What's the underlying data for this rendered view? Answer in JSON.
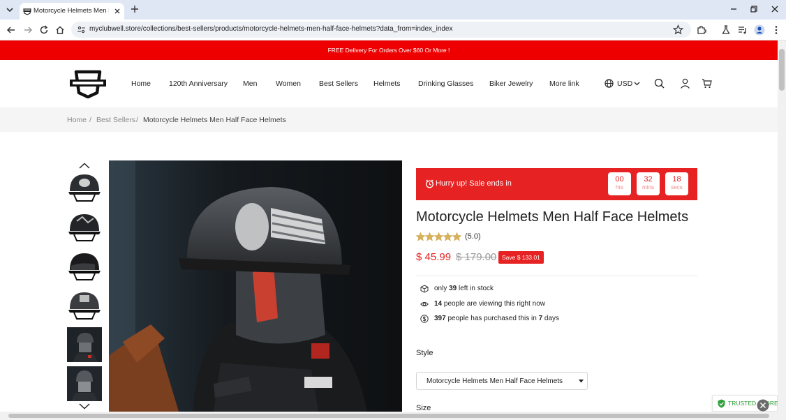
{
  "browser": {
    "tab_title": "Motorcycle Helmets Men Half F",
    "url": "myclubwell.store/collections/best-sellers/products/motorcycle-helmets-men-half-face-helmets?data_from=index_index"
  },
  "announcement": "FREE Delivery For Orders Over $60 Or More !",
  "nav": {
    "items": [
      "Home",
      "120th Anniversary",
      "Men",
      "Women",
      "Best Sellers",
      "Helmets",
      "Drinking Glasses",
      "Biker Jewelry",
      "More link"
    ],
    "currency": "USD"
  },
  "breadcrumb": [
    "Home",
    "Best Sellers",
    "Motorcycle Helmets Men Half Face Helmets"
  ],
  "sale": {
    "label": "Hurry up!  Sale ends in",
    "countdown": [
      {
        "value": "00",
        "unit": "hrs"
      },
      {
        "value": "32",
        "unit": "mins"
      },
      {
        "value": "18",
        "unit": "secs"
      }
    ]
  },
  "product": {
    "title": "Motorcycle Helmets Men Half Face Helmets",
    "rating": 5.0,
    "rating_text": "(5.0)",
    "price": "$ 45.99",
    "compare_price": "$ 179.00",
    "save_badge": "Save $ 133.01",
    "info": {
      "stock_prefix": "only ",
      "stock_count": "39",
      "stock_suffix": " left in stock",
      "viewing_count": "14",
      "viewing_suffix": " people are viewing this right now",
      "purchased_count": "397",
      "purchased_mid": " people has purchased this in ",
      "purchased_days": "7",
      "purchased_suffix": " days"
    },
    "style_label": "Style",
    "style_value": "Motorcycle Helmets Men Half Face Helmets",
    "size_label": "Size"
  },
  "trusted_badge": "TRUSTED STORE",
  "colors": {
    "accent_red": "#ee0000",
    "sale_red": "#e62222",
    "trusted_green": "#2e9f3a"
  }
}
